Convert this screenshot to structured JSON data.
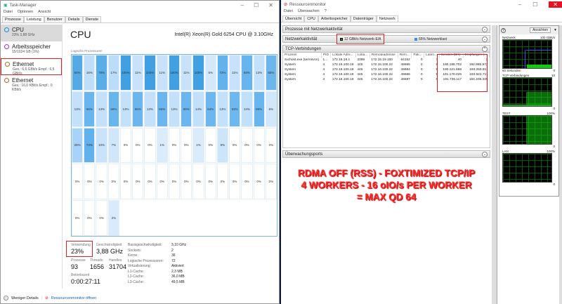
{
  "taskmanager": {
    "title": "Task-Manager",
    "menu": [
      "Datei",
      "Optionen",
      "Ansicht"
    ],
    "tabs": [
      "Prozesse",
      "Leistung",
      "Benutzer",
      "Details",
      "Dienste"
    ],
    "sidebar": [
      {
        "title": "CPU",
        "sub": "23% 3,88 GHz",
        "color": "#1a8fd6"
      },
      {
        "title": "Arbeitsspeicher",
        "sub": "15/1024 GB (1%)",
        "color": "#9b32c8"
      },
      {
        "title": "Ethernet",
        "sub": "Ges.: 6,6 GBit/s Empf.: 6,5 GBit/s",
        "color": "#b5651d"
      },
      {
        "title": "Ethernet",
        "sub": "Ges.: 16,0 KBit/s Empf.: 0 KBit/s",
        "color": "#b5651d"
      }
    ],
    "cpu_title": "CPU",
    "cpu_model": "Intel(R) Xeon(R) Gold 6254 CPU @ 3.10GHz",
    "grid_label": "Logische Prozessoren",
    "cores": [
      84,
      16,
      79,
      17,
      100,
      11,
      100,
      11,
      100,
      11,
      100,
      5,
      72,
      11,
      68,
      13,
      65,
      13,
      66,
      13,
      66,
      13,
      65,
      13,
      65,
      13,
      65,
      14,
      64,
      13,
      63,
      14,
      66,
      6,
      28,
      73,
      10,
      7,
      0,
      0,
      0,
      1,
      0,
      0,
      1,
      0,
      8,
      0,
      0,
      0,
      0,
      0,
      0,
      0,
      0,
      0,
      0,
      0,
      0,
      0,
      0,
      0,
      0,
      0,
      0,
      0,
      0,
      0,
      0,
      0,
      0,
      2
    ],
    "stats": {
      "usage_label": "Verwendung",
      "usage": "23%",
      "speed_label": "Geschwindigkeit",
      "speed": "3,88 GHz",
      "proc_label": "Prozesse",
      "proc": "93",
      "threads_label": "Threads",
      "threads": "1656",
      "handles_label": "Handles",
      "handles": "31704",
      "uptime_label": "Betriebszeit",
      "uptime": "0:00:27:11"
    },
    "details": [
      {
        "k": "Basisgeschwindigkeit:",
        "v": "3,10 GHz"
      },
      {
        "k": "Sockets:",
        "v": "2"
      },
      {
        "k": "Kerne:",
        "v": "36"
      },
      {
        "k": "Logische Prozessoren:",
        "v": "72"
      },
      {
        "k": "Virtualisierung:",
        "v": "Aktiviert"
      },
      {
        "k": "L1-Cache:",
        "v": "2,3 MB"
      },
      {
        "k": "L2-Cache:",
        "v": "36,0 MB"
      },
      {
        "k": "L3-Cache:",
        "v": "49,5 MB"
      }
    ],
    "footer": {
      "less": "Weniger Details",
      "resmon": "Ressourcenmonitor öffnen"
    }
  },
  "resmon": {
    "title": "Ressourcenmonitor",
    "menu": [
      "Datei",
      "Überwachen",
      "?"
    ],
    "tabs": [
      "Übersicht",
      "CPU",
      "Arbeitsspeicher",
      "Datenträger",
      "Netzwerk"
    ],
    "sections": {
      "procs": "Prozesse mit Netzwerkaktivität",
      "netact": "Netzwerkaktivität",
      "netio": "12 GBit/s Netzwerk-E/A",
      "netload": "65% Netzwerklast",
      "tcp": "TCP-Verbindungen",
      "ports": "Überwachungsports"
    },
    "columns": [
      "Prozess",
      "PID",
      "Lokale Adre...",
      "Loka...",
      "Remoteadresse",
      "Rem...",
      "Pak...",
      "Laten...",
      "Senden (B/s)",
      "Empfangen (..."
    ],
    "rows": [
      [
        "svchost.exe (termsvcs)",
        "1...",
        "172.16.19.1",
        "3389",
        "172.16.19.100",
        "64152",
        "0",
        "7",
        "40",
        "2"
      ],
      [
        "System",
        "4",
        "172.16.100.19",
        "445",
        "172.16.100.22",
        "49685",
        "0",
        "5",
        "190.188.702",
        "192.985.972"
      ],
      [
        "System",
        "4",
        "172.16.100.19",
        "445",
        "172.16.100.22",
        "49684",
        "0",
        "5",
        "190.121.568",
        "193.259.811"
      ],
      [
        "System",
        "4",
        "172.16.100.19",
        "445",
        "172.16.100.22",
        "49686",
        "0",
        "5",
        "191.170.026",
        "193.922.711"
      ],
      [
        "System",
        "4",
        "172.16.100.19",
        "445",
        "172.16.100.22",
        "49687",
        "0",
        "5",
        "191.736.117",
        "194.409.335"
      ]
    ],
    "views": "Ansichten",
    "graphs": [
      {
        "name": "Netzwerk",
        "max": "100 GBit/s",
        "min": "0",
        "foot": "60 Sekunden"
      },
      {
        "name": "TCP-Verbindungen",
        "max": "10",
        "min": "0"
      },
      {
        "name": "TEST",
        "max": "100%",
        "min": "0"
      },
      {
        "name": "LAN",
        "max": "100%",
        "min": "0"
      }
    ]
  },
  "banner": [
    "RDMA OFF (RSS) - FOXTIMIZED TCP/IP",
    "4 WORKERS - 16 oIO/s PER WORKER",
    "= MAX QD 64"
  ]
}
